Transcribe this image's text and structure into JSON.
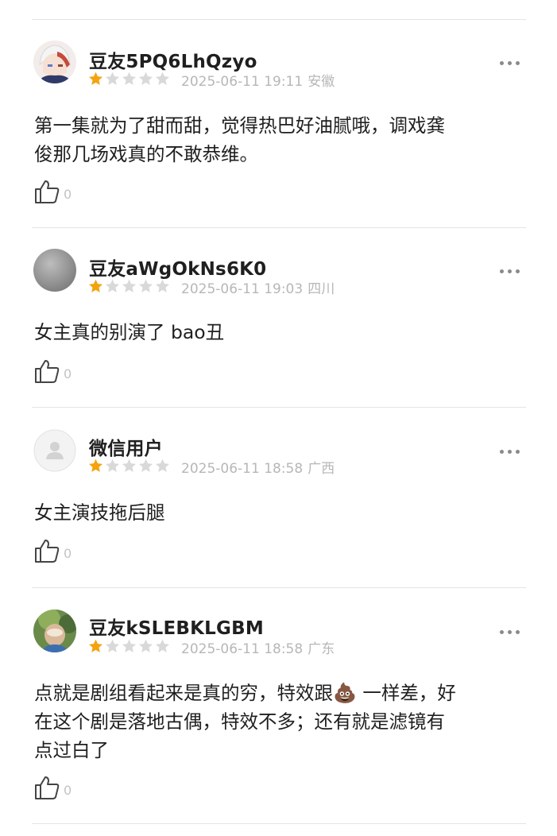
{
  "comments": [
    {
      "username": "豆友5PQ6LhQzyo",
      "rating": 1,
      "date": "2025-06-11 19:11",
      "location": "安徽",
      "content": "第一集就为了甜而甜，觉得热巴好油腻哦，调戏龚\n俊那几场戏真的不敢恭维。",
      "likes": "0"
    },
    {
      "username": "豆友aWgOkNs6K0",
      "rating": 1,
      "date": "2025-06-11 19:03",
      "location": "四川",
      "content": "女主真的别演了 bao丑",
      "likes": "0"
    },
    {
      "username": "微信用户",
      "rating": 1,
      "date": "2025-06-11 18:58",
      "location": "广西",
      "content": "女主演技拖后腿",
      "likes": "0"
    },
    {
      "username": "豆友kSLEBKLGBM",
      "rating": 1,
      "date": "2025-06-11 18:58",
      "location": "广东",
      "content_before_emoji": "点就是剧组看起来是真的穷，特效跟",
      "content_after_emoji": " 一样差，好\n在这个剧是落地古偶，特效不多；还有就是滤镜有\n点过白了",
      "emoji": "💩",
      "likes": "0"
    }
  ],
  "colors": {
    "star_filled": "#f4a30e",
    "star_empty": "#d9d9d9",
    "meta_text": "#b7b7b7"
  },
  "icons": {
    "more": "more-dots-icon",
    "like": "thumbs-up-icon",
    "star": "star-icon"
  }
}
